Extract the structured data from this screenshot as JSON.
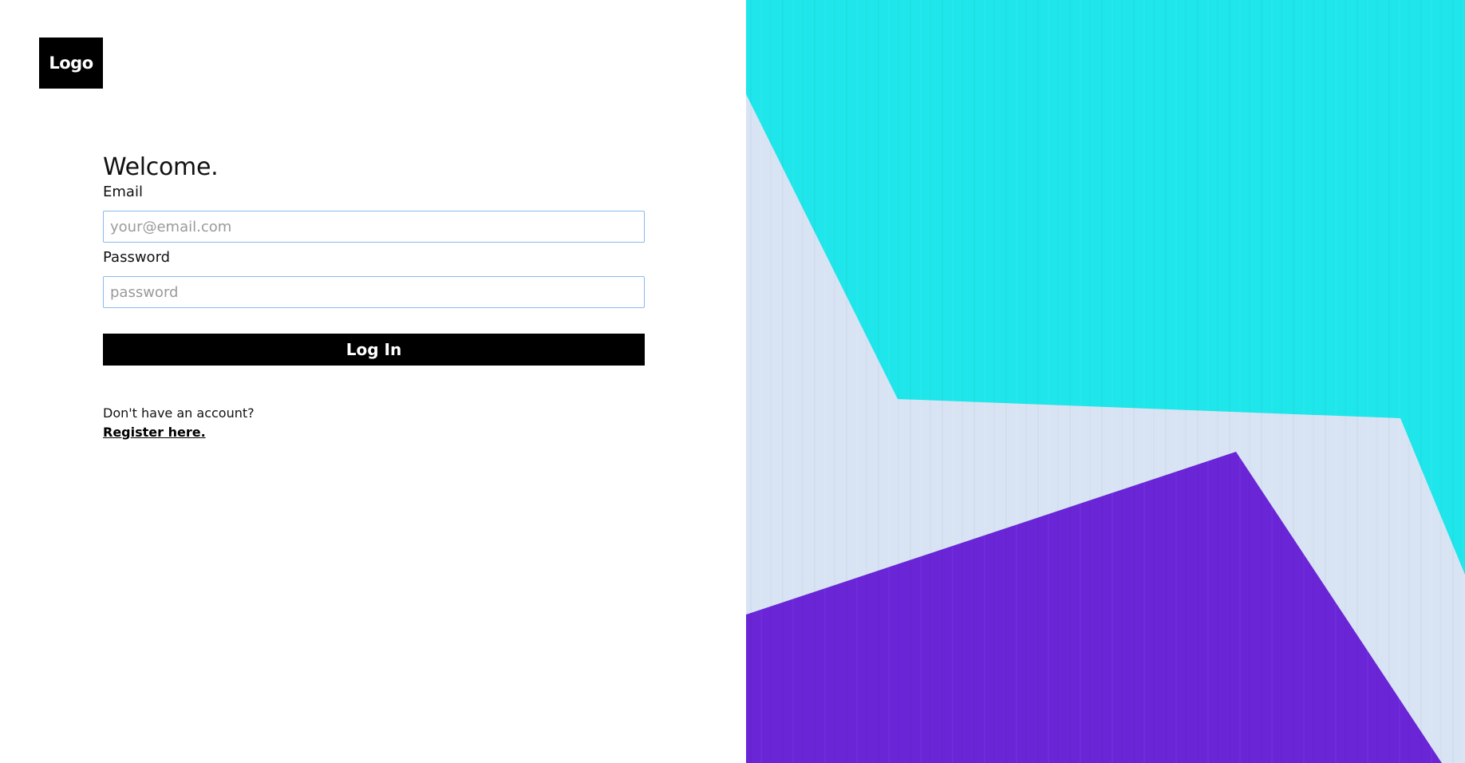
{
  "logo": {
    "label": "Logo"
  },
  "login": {
    "title": "Welcome.",
    "email_label": "Email",
    "email_placeholder": "your@email.com",
    "email_value": "",
    "password_label": "Password",
    "password_placeholder": "password",
    "password_value": "",
    "submit_label": "Log In",
    "no_account_text": "Don't have an account?",
    "register_link": "Register here."
  },
  "colors": {
    "primary": "#000000",
    "input_border": "#8ab9ee",
    "art_cyan": "#1fe6ea",
    "art_purple": "#6a25d6",
    "art_pale_blue": "#d8e4f4"
  }
}
